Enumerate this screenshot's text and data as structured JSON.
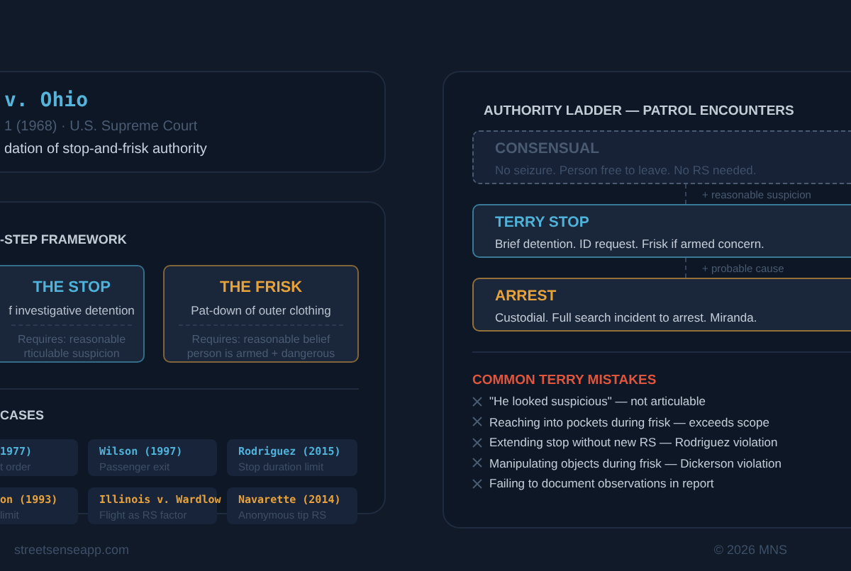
{
  "case_card": {
    "title": "v. Ohio",
    "citation": "1 (1968) · U.S. Supreme Court",
    "description": "dation of stop-and-frisk authority"
  },
  "framework": {
    "heading": "-STEP FRAMEWORK",
    "steps": [
      {
        "title": "THE STOP",
        "description": "f investigative detention",
        "requirement": [
          "Requires: reasonable",
          "rticulable suspicion"
        ],
        "color": "#4fb3d9"
      },
      {
        "title": "THE FRISK",
        "description": "Pat-down of outer clothing",
        "requirement": [
          "Requires: reasonable belief",
          "person is armed + dangerous"
        ],
        "color": "#e8a23a"
      }
    ],
    "cases_heading": "CASES",
    "cases": [
      {
        "name": "1977)",
        "holding": "t order",
        "color": "#4fb3d9"
      },
      {
        "name": "Wilson (1997)",
        "holding": "Passenger exit",
        "color": "#4fb3d9"
      },
      {
        "name": "Rodriguez (2015)",
        "holding": "Stop duration limit",
        "color": "#4fb3d9"
      },
      {
        "name": "on (1993)",
        "holding": "limit",
        "color": "#e8a23a"
      },
      {
        "name": "Illinois v. Wardlow",
        "holding": "Flight as RS factor",
        "color": "#e8a23a"
      },
      {
        "name": "Navarette (2014)",
        "holding": "Anonymous tip RS",
        "color": "#e8a23a"
      }
    ]
  },
  "ladder": {
    "title": "AUTHORITY LADDER — PATROL ENCOUNTERS",
    "levels": [
      {
        "name": "CONSENSUAL",
        "description": "No seizure. Person free to leave. No RS needed.",
        "color": "#4a5a70",
        "threshold": "+ reasonable suspicion"
      },
      {
        "name": "TERRY STOP",
        "description": "Brief detention. ID request. Frisk if armed concern.",
        "color": "#4fb3d9",
        "threshold": "+ probable cause"
      },
      {
        "name": "ARREST",
        "description": "Custodial. Full search incident to arrest. Miranda.",
        "color": "#e8a23a"
      }
    ]
  },
  "mistakes": {
    "heading": "COMMON TERRY MISTAKES",
    "items": [
      "\"He looked suspicious\" — not articulable",
      "Reaching into pockets during frisk — exceeds scope",
      "Extending stop without new RS — Rodriguez violation",
      "Manipulating objects during frisk — Dickerson violation",
      "Failing to document observations in report"
    ]
  },
  "footer": {
    "site": "streetsenseapp.com",
    "copyright": "© 2026 MNS"
  }
}
